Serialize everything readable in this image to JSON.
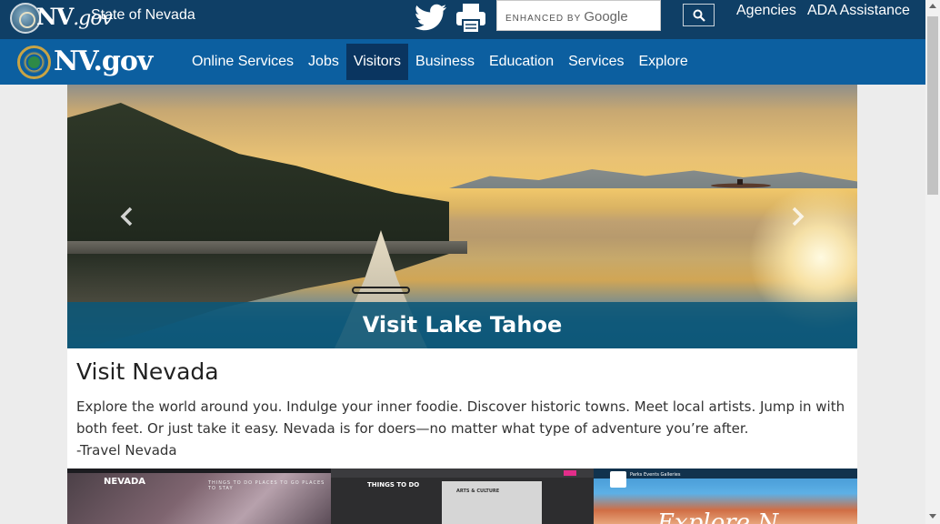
{
  "header": {
    "brand": "NV",
    "brand_gov": ".gov",
    "state_name": "State of Nevada",
    "search": {
      "placeholder_prefix": "ENHANCED BY",
      "placeholder_brand": "Google",
      "value": ""
    },
    "links": [
      "Agencies",
      "ADA Assistance"
    ]
  },
  "nav": {
    "logo_text": "NV.gov",
    "items": [
      "Online Services",
      "Jobs",
      "Visitors",
      "Business",
      "Education",
      "Services",
      "Explore"
    ],
    "active": "Visitors"
  },
  "hero": {
    "caption": "Visit Lake Tahoe"
  },
  "main": {
    "title": "Visit Nevada",
    "body": "Explore the world around you. Indulge your inner foodie. Discover historic towns. Meet local artists. Jump in with both feet. Or just take it easy. Nevada is for doers—no matter what type of adventure you’re after.",
    "source": "-Travel Nevada"
  },
  "thumbnails": {
    "t1_brand": "NEVADA",
    "t1_links": "THINGS TO DO   PLACES TO GO   PLACES TO STAY",
    "t2_side": "THINGS TO DO",
    "t2_panel": "ARTS & CULTURE",
    "t3_nav": "Parks   Events   Galleries",
    "t3_script": "Explore N"
  },
  "colors": {
    "topbar": "#0f3f66",
    "navbar": "#0c5fa0",
    "nav_active": "#0a3560",
    "caption": "#0b5678"
  }
}
